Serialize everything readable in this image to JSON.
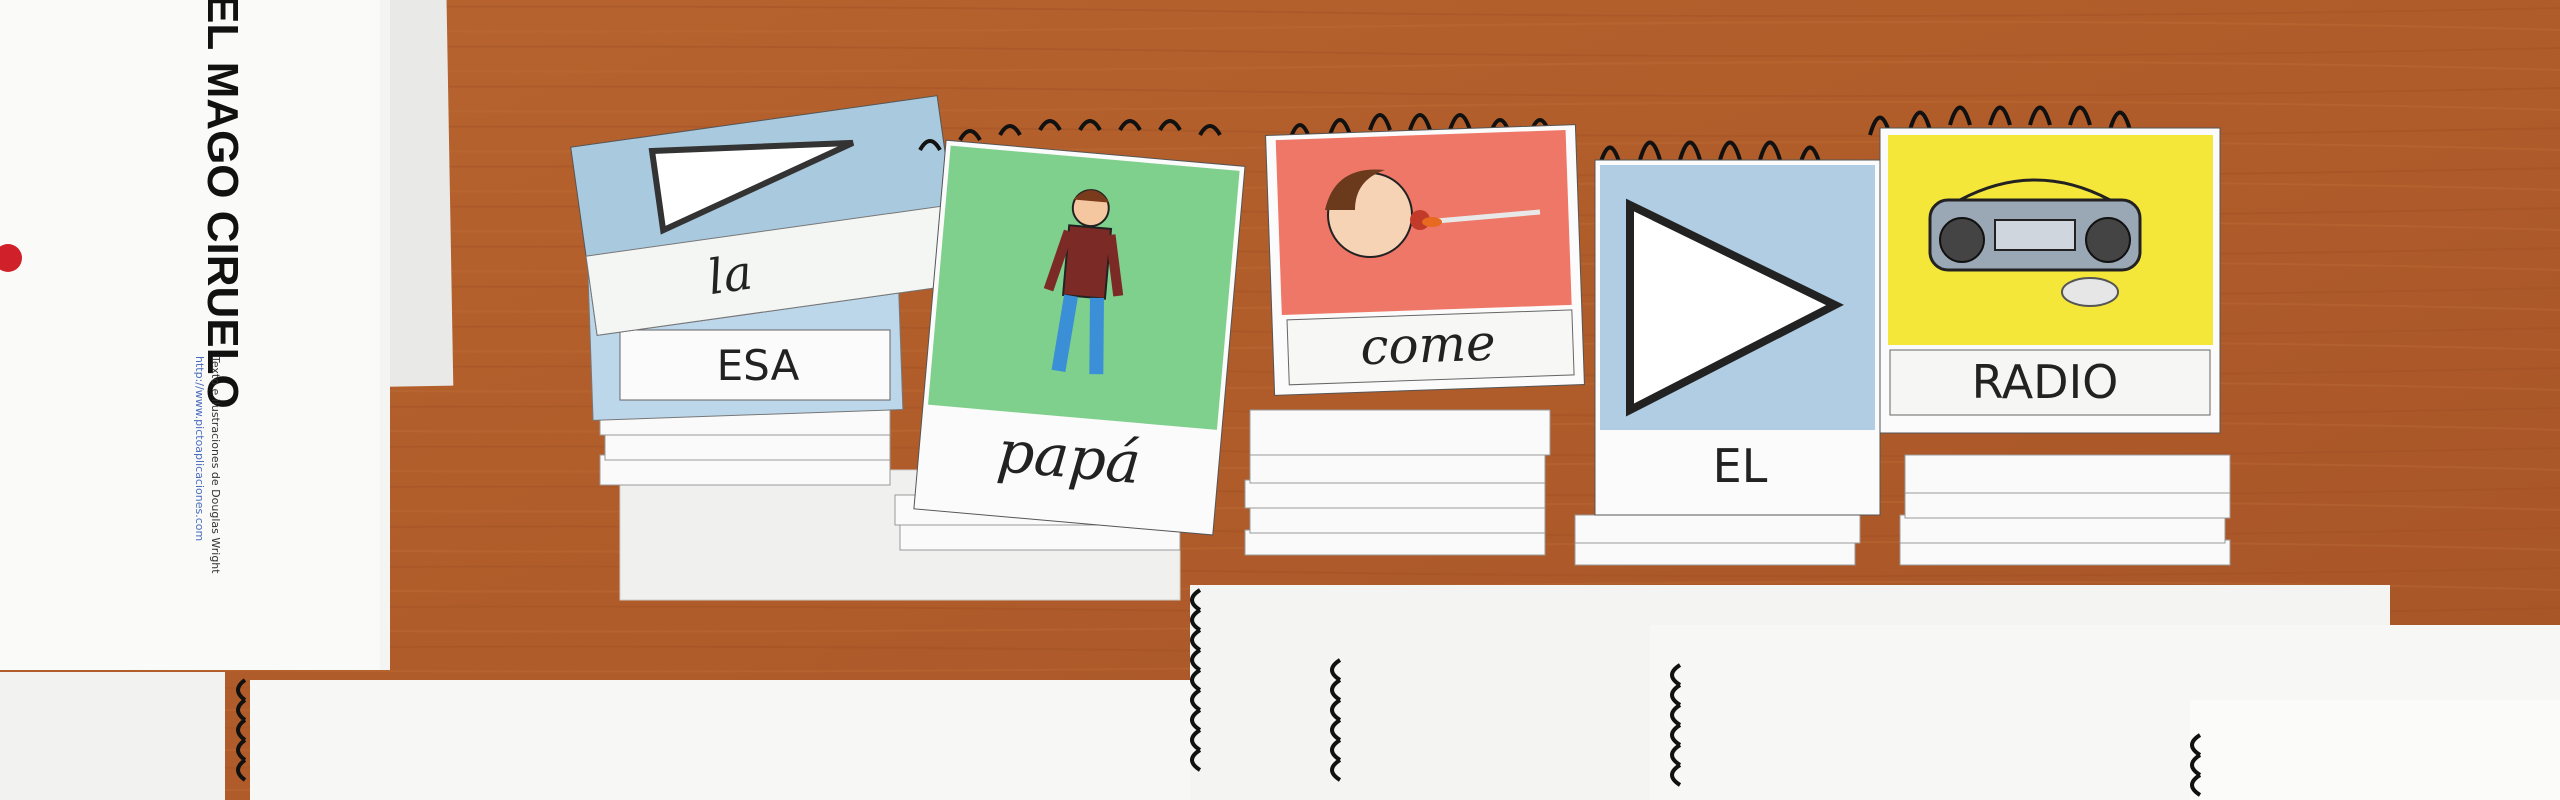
{
  "scene": {
    "description_visible_text": true,
    "colors": {
      "table": "#b5622f",
      "table_dark": "#9a4f25",
      "card_blue": "#a8c8de",
      "card_green": "#7fcf8a",
      "card_red": "#ef7b6e",
      "card_yellow": "#f4e53a",
      "paper": "#f7f7f5"
    }
  },
  "book": {
    "title": "EL MAGO CIRUELO",
    "credit_line1": "Texto e ilustraciones de Douglas Wright",
    "credit_line2": "http://www.pictoaplicaciones.com"
  },
  "flipbooks": [
    {
      "top_label": "la",
      "under_label": "ESA",
      "icon": "play-triangle-icon"
    },
    {
      "top_label": "papá",
      "icon": "man-icon"
    },
    {
      "top_label": "come",
      "icon": "eating-icon"
    },
    {
      "top_label": "EL",
      "icon": "play-triangle-icon"
    },
    {
      "top_label": "RADIO",
      "icon": "radio-icon"
    }
  ]
}
